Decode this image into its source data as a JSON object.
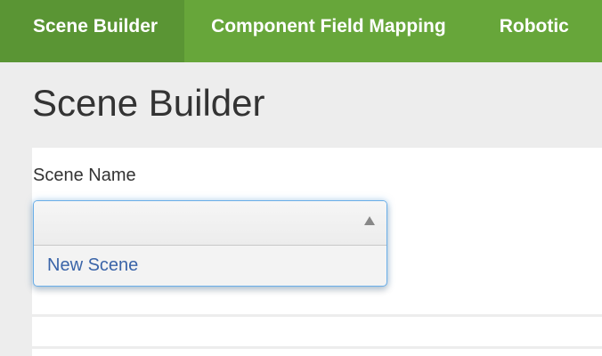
{
  "nav": {
    "tabs": [
      {
        "label": "Scene Builder",
        "active": true
      },
      {
        "label": "Component Field Mapping",
        "active": false
      },
      {
        "label": "Robotic",
        "active": false
      }
    ]
  },
  "page": {
    "title": "Scene Builder"
  },
  "form": {
    "scene_name_label": "Scene Name",
    "scene_name_value": "",
    "options": [
      "New Scene"
    ]
  },
  "colors": {
    "nav": "#67a63a",
    "nav_active": "#5a9534",
    "option_text": "#3a64a8",
    "focus": "#6aaee8"
  }
}
